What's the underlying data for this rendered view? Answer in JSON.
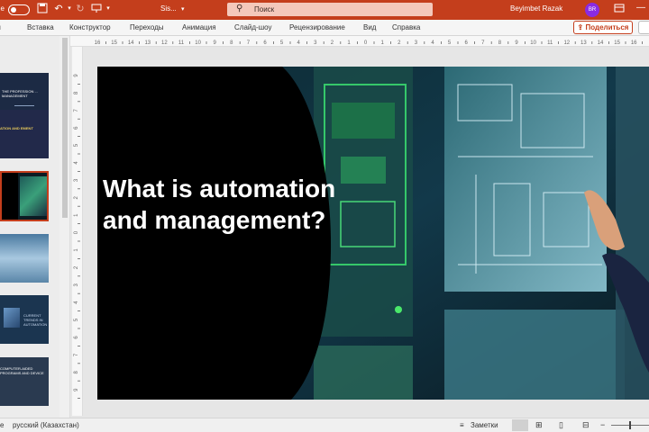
{
  "titlebar": {
    "file_name": "Sis...",
    "search_placeholder": "Поиск",
    "user_name": "Beyimbet Razak",
    "user_initials": "BR",
    "accent_color": "#c43e1c"
  },
  "menu": {
    "items": [
      "Вставка",
      "Конструктор",
      "Переходы",
      "Анимация",
      "Слайд-шоу",
      "Рецензирование",
      "Вид",
      "Справка"
    ],
    "share_label": "Поделиться"
  },
  "slide": {
    "title": "What is automation and management?"
  },
  "thumbnails": {
    "t1_text": "THE PROFESSION ... MANAGEMENT",
    "t2_text": "ATION AND EMENT",
    "t5_text": "CURRENT TRENDS IN AUTOMATION",
    "t6_text": "COMPUTER-AIDED PROGRAMS AND DEVICE"
  },
  "statusbar": {
    "language": "русский (Казахстан)",
    "notes_label": "Заметки"
  },
  "icons": [
    "undo-icon",
    "redo-icon",
    "save-icon",
    "search-icon",
    "notes-icon",
    "normal-view-icon",
    "sorter-view-icon",
    "reading-view-icon",
    "slideshow-icon"
  ]
}
